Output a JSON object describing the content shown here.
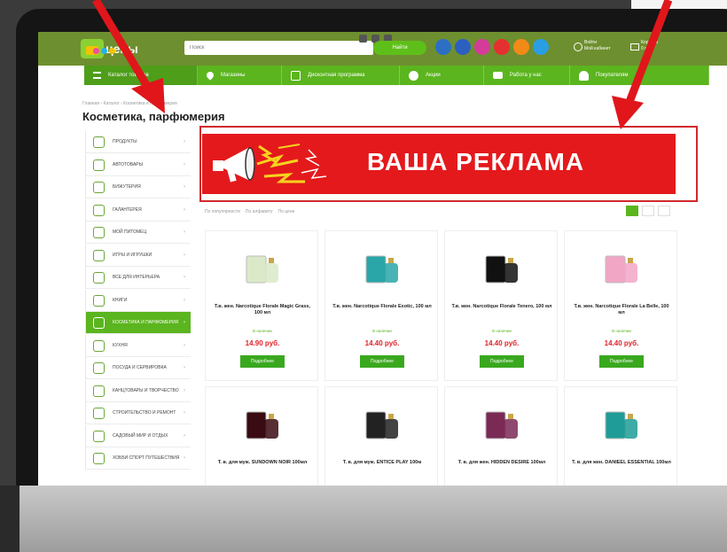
{
  "header": {
    "logo_text": "цены",
    "search_placeholder": "Поиск",
    "search_button": "Найти",
    "login_label": "Войти",
    "login_sub": "Мой кабинет",
    "cart_label": "Корзина",
    "cart_sub": "0 руб."
  },
  "nav": {
    "catalog": "Каталог товаров",
    "shops": "Магазины",
    "loyalty": "Дисконтная программа",
    "sales": "Акции",
    "work": "Работа у нас",
    "buyers": "Покупателям"
  },
  "breadcrumb": "Главная › Каталог › Косметика и парфюмерия",
  "page_title": "Косметика, парфюмерия",
  "sidebar": {
    "items": [
      {
        "label": "ПРОДУКТЫ",
        "active": false
      },
      {
        "label": "АВТОТОВАРЫ",
        "active": false
      },
      {
        "label": "БИЖУТЕРИЯ",
        "active": false
      },
      {
        "label": "ГАЛАНТЕРЕЯ",
        "active": false
      },
      {
        "label": "МОЙ ПИТОМЕЦ",
        "active": false
      },
      {
        "label": "ИГРЫ И ИГРУШКИ",
        "active": false
      },
      {
        "label": "ВСЕ ДЛЯ ИНТЕРЬЕРА",
        "active": false
      },
      {
        "label": "КНИГИ",
        "active": false
      },
      {
        "label": "КОСМЕТИКА И ПАРФЮМЕРИЯ",
        "active": true
      },
      {
        "label": "КУХНЯ",
        "active": false
      },
      {
        "label": "ПОСУДА И СЕРВИРОВКА",
        "active": false
      },
      {
        "label": "КАНЦТОВАРЫ И ТВОРЧЕСТВО",
        "active": false
      },
      {
        "label": "СТРОИТЕЛЬСТВО И РЕМОНТ",
        "active": false
      },
      {
        "label": "САДОВЫЙ МИР И ОТДЫХ",
        "active": false
      },
      {
        "label": "ХОББИ СПОРТ ПУТЕШЕСТВИЯ",
        "active": false
      }
    ]
  },
  "banner": {
    "text": "ВАША РЕКЛАМА",
    "bg": "#e4191c"
  },
  "sort": {
    "popularity": "По популярности",
    "alphabet": "По алфавиту",
    "price": "По цене"
  },
  "products": [
    {
      "name": "Т.в. жен. Narcotique Florale Magic Grass, 100 мл",
      "stock": "В наличии",
      "price": "14.90 руб.",
      "button": "Подробнее",
      "bottle": "#dbe9c8"
    },
    {
      "name": "Т.в. жен. Narcotique Florale Exotic, 100 мл",
      "stock": "В наличии",
      "price": "14.40 руб.",
      "button": "Подробнее",
      "bottle": "#2aa6a8"
    },
    {
      "name": "Т.в. жен. Narcotique Florale Tenero, 100 мл",
      "stock": "В наличии",
      "price": "14.40 руб.",
      "button": "Подробнее",
      "bottle": "#111111"
    },
    {
      "name": "Т.в. жен. Narcotique Florale La Belle, 100 мл",
      "stock": "В наличии",
      "price": "14.40 руб.",
      "button": "Подробнее",
      "bottle": "#f2a6c6"
    },
    {
      "name": "Т. в. для муж. SUNDOWN NOIR 100мл",
      "stock": "",
      "price": "",
      "button": "",
      "bottle": "#3a0b12"
    },
    {
      "name": "Т. в. для муж. ENTICE PLAY 100м",
      "stock": "",
      "price": "",
      "button": "",
      "bottle": "#222222"
    },
    {
      "name": "Т. в. для жен. HIDDEN DESIRE 100мл",
      "stock": "",
      "price": "",
      "button": "",
      "bottle": "#7a2a55"
    },
    {
      "name": "Т. в. для жен. DANIEEL ESSENTIAL 100мл",
      "stock": "",
      "price": "",
      "button": "",
      "bottle": "#1f9c97"
    }
  ],
  "colors": {
    "brand_green": "#5bb51e",
    "header_green": "#6e8f2f",
    "price_red": "#e0222a",
    "arrow_red": "#e0161b"
  }
}
